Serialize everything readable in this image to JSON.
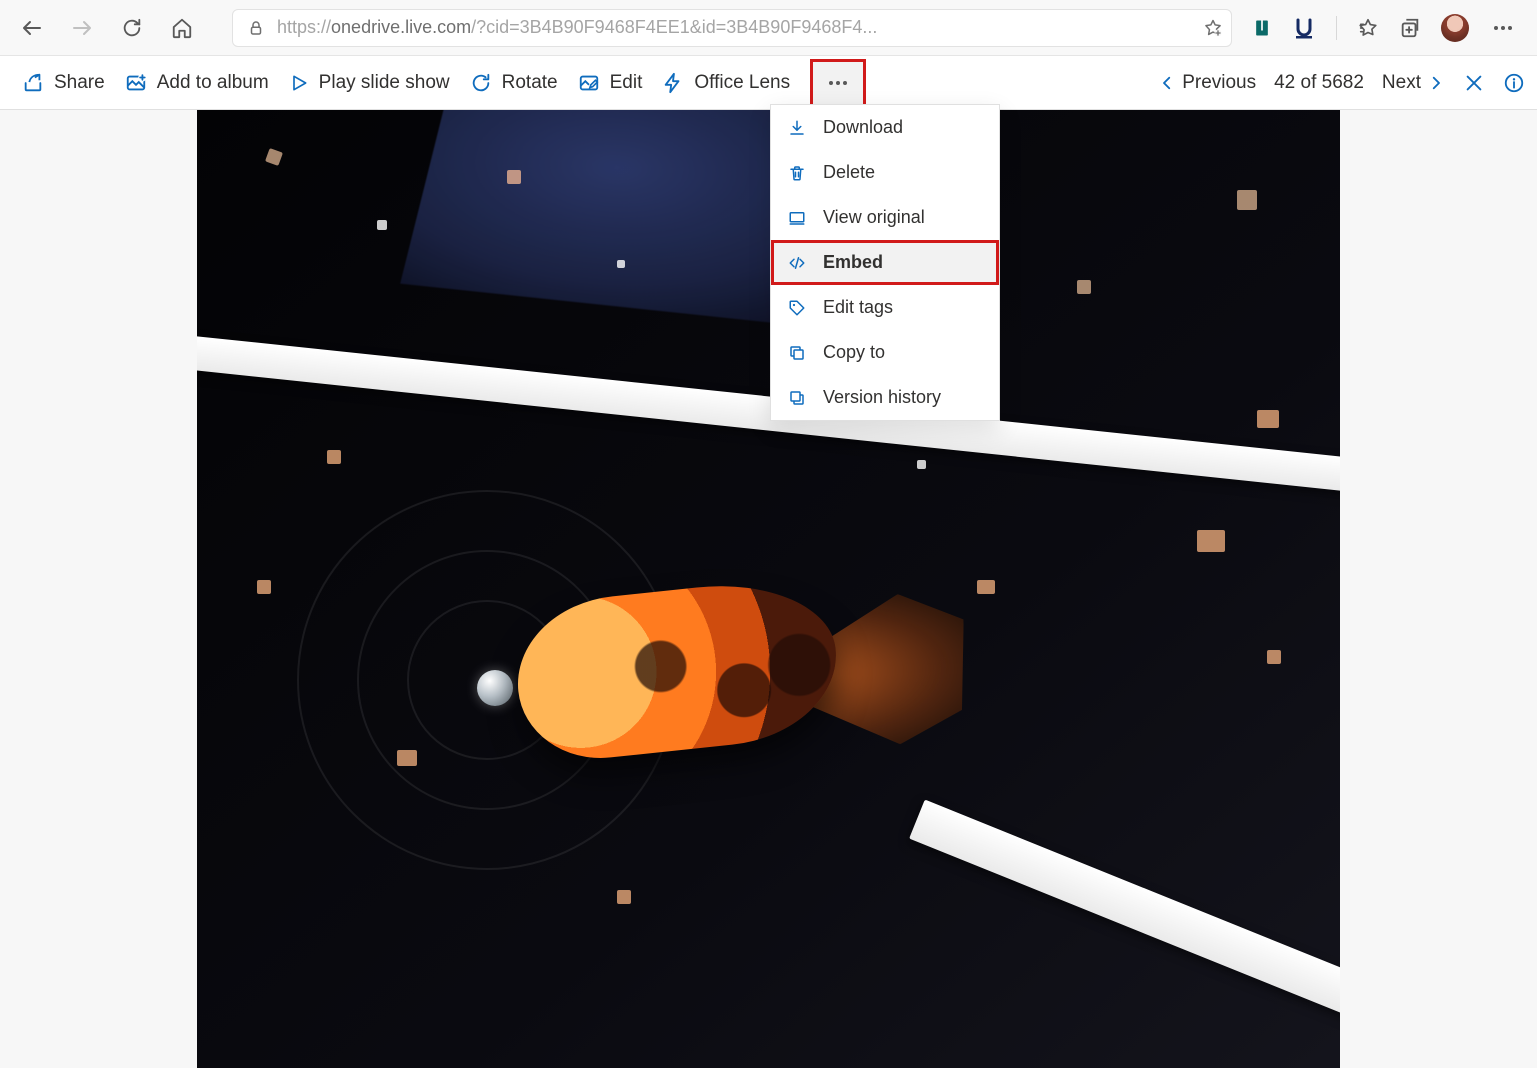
{
  "browser": {
    "url_host": "onedrive.live.com",
    "url_path": "/?cid=3B4B90F9468F4EE1&id=3B4B90F9468F4..."
  },
  "toolbar": {
    "share": "Share",
    "add_to_album": "Add to album",
    "play_slide_show": "Play slide show",
    "rotate": "Rotate",
    "edit": "Edit",
    "office_lens": "Office Lens"
  },
  "menu": {
    "download": "Download",
    "delete": "Delete",
    "view_original": "View original",
    "embed": "Embed",
    "edit_tags": "Edit tags",
    "copy_to": "Copy to",
    "version_history": "Version history"
  },
  "nav": {
    "previous": "Previous",
    "next": "Next",
    "counter": "42 of 5682"
  }
}
